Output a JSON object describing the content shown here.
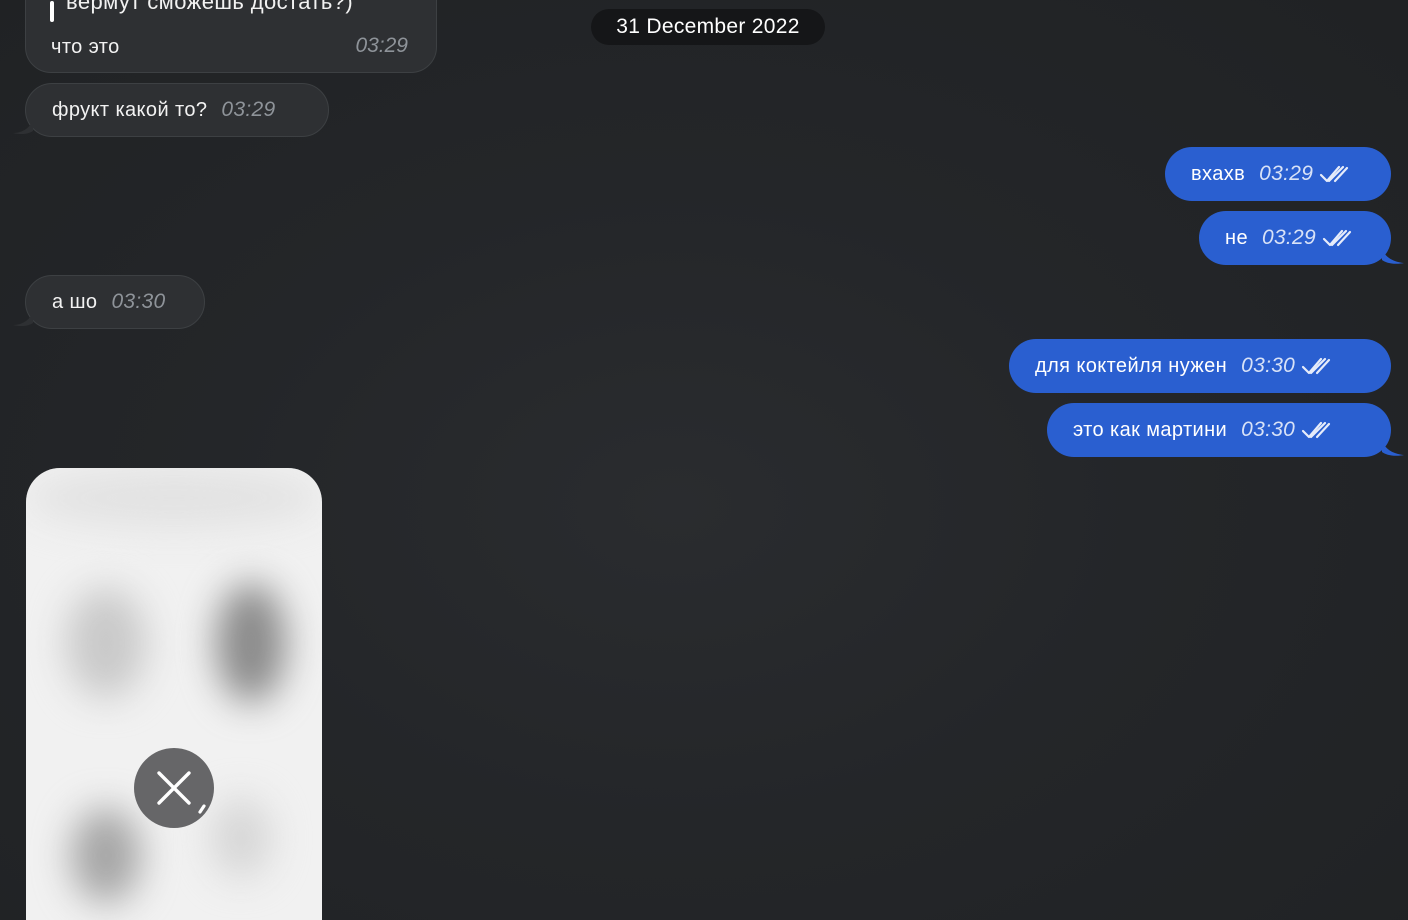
{
  "date_separator": "31 December 2022",
  "messages": {
    "m1": {
      "direction": "in",
      "reply_quote": "вермут сможешь достать?)",
      "text": "что это",
      "time": "03:29"
    },
    "m2": {
      "direction": "in",
      "text": "фрукт какой то?",
      "time": "03:29"
    },
    "m3": {
      "direction": "out",
      "text": "вхахв",
      "time": "03:29",
      "status_icon": "double-check-icon"
    },
    "m4": {
      "direction": "out",
      "text": "не",
      "time": "03:29",
      "status_icon": "double-check-icon"
    },
    "m5": {
      "direction": "in",
      "text": "а шо",
      "time": "03:30"
    },
    "m6": {
      "direction": "out",
      "text": "для коктейля нужен",
      "time": "03:30",
      "status_icon": "double-check-icon"
    },
    "m7": {
      "direction": "out",
      "text": "это как мартини",
      "time": "03:30",
      "status_icon": "double-check-icon"
    }
  },
  "media": {
    "type": "blurred-image",
    "overlay_icon": "close-icon"
  },
  "colors": {
    "background": "#232528",
    "incoming_bubble": "#2e3033",
    "outgoing_bubble": "#2a5fd0",
    "date_pill": "#151618",
    "time_incoming": "#8e9399"
  }
}
